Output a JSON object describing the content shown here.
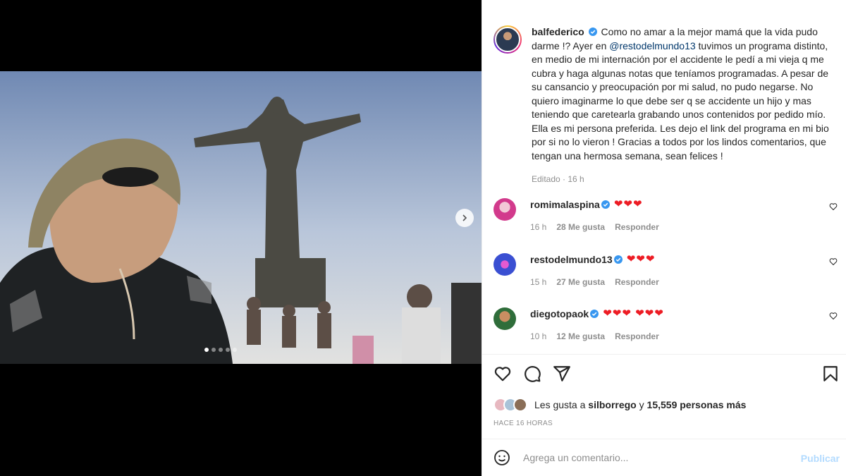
{
  "post": {
    "username": "balfederico",
    "caption_before_mention": "Como no amar a la mejor mamá que la vida pudo darme !? Ayer en ",
    "mention": "@restodelmundo13",
    "caption_after_mention": " tuvimos un programa distinto, en medio de mi internación por el accidente le pedí a mi vieja q me cubra y haga algunas notas que teníamos programadas. A pesar de su cansancio y preocupación por mi salud, no pudo negarse. No quiero imaginarme lo que debe ser q se accidente un hijo y mas teniendo que caretearla grabando unos contenidos por pedido mío. Ella es mi persona preferida. Les dejo el link del programa en mi bio por si no lo vieron ! Gracias a todos por los lindos comentarios, que tengan una hermosa semana, sean felices !",
    "edited_label": "Editado · 16 h"
  },
  "carousel": {
    "total": 5,
    "active": 0
  },
  "comments": [
    {
      "username": "romimalaspina",
      "text": "❤❤❤",
      "time": "16 h",
      "likes": "28 Me gusta",
      "reply": "Responder",
      "avatar_color": "#d23a8c"
    },
    {
      "username": "restodelmundo13",
      "text": "❤❤❤",
      "time": "15 h",
      "likes": "27 Me gusta",
      "reply": "Responder",
      "avatar_color": "#3a4fd2"
    },
    {
      "username": "diegotopaok",
      "text": "❤❤❤ ❤❤❤",
      "time": "10 h",
      "likes": "12 Me gusta",
      "reply": "Responder",
      "avatar_color": "#2f6d3a"
    }
  ],
  "likes": {
    "prefix": "Les gusta a ",
    "user": "silborrego",
    "connector": " y ",
    "count": "15,559 personas más"
  },
  "time_ago": "HACE 16 HORAS",
  "add_comment": {
    "placeholder": "Agrega un comentario...",
    "publish": "Publicar"
  },
  "colors": {
    "verified": "#3897f0",
    "link": "#00376b",
    "heart": "#ed1c24",
    "publish_disabled": "#b3dbff"
  }
}
